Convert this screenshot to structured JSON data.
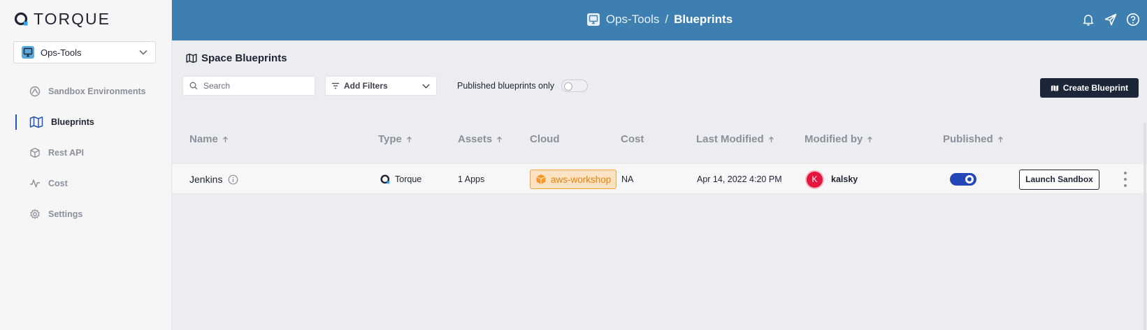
{
  "app": {
    "logo_text": "TORQUE"
  },
  "sidebar": {
    "space_selector": {
      "value": "Ops-Tools"
    },
    "items": [
      {
        "label": "Sandbox Environments",
        "icon": "sandbox-icon",
        "active": false
      },
      {
        "label": "Blueprints",
        "icon": "map-icon",
        "active": true
      },
      {
        "label": "Rest API",
        "icon": "cube-icon",
        "active": false
      },
      {
        "label": "Cost",
        "icon": "pulse-icon",
        "active": false
      },
      {
        "label": "Settings",
        "icon": "gear-icon",
        "active": false
      }
    ]
  },
  "topbar": {
    "space": "Ops-Tools",
    "separator": "/",
    "page": "Blueprints",
    "icons": [
      "bell-icon",
      "send-icon",
      "help-icon"
    ]
  },
  "main": {
    "title": "Space Blueprints",
    "search": {
      "placeholder": "Search",
      "value": ""
    },
    "filters": {
      "label": "Add Filters"
    },
    "published_only": {
      "label": "Published blueprints only",
      "on": false
    },
    "create_button": "Create Blueprint",
    "table": {
      "columns": [
        "Name",
        "Type",
        "Assets",
        "Cloud",
        "Cost",
        "Last Modified",
        "Modified by",
        "Published"
      ],
      "rows": [
        {
          "name": "Jenkins",
          "type": "Torque",
          "assets": "1 Apps",
          "cloud": "aws-workshop",
          "cost": "NA",
          "last_modified": "Apr 14, 2022 4:20 PM",
          "modified_by": {
            "initial": "K",
            "name": "kalsky"
          },
          "published": true,
          "action": "Launch Sandbox"
        }
      ]
    }
  },
  "colors": {
    "topbar": "#3d7fb0",
    "primary_button": "#1c2639",
    "toggle_on": "#2347b8",
    "cloud_badge": "#f6a33c",
    "avatar": "#e2163f"
  }
}
